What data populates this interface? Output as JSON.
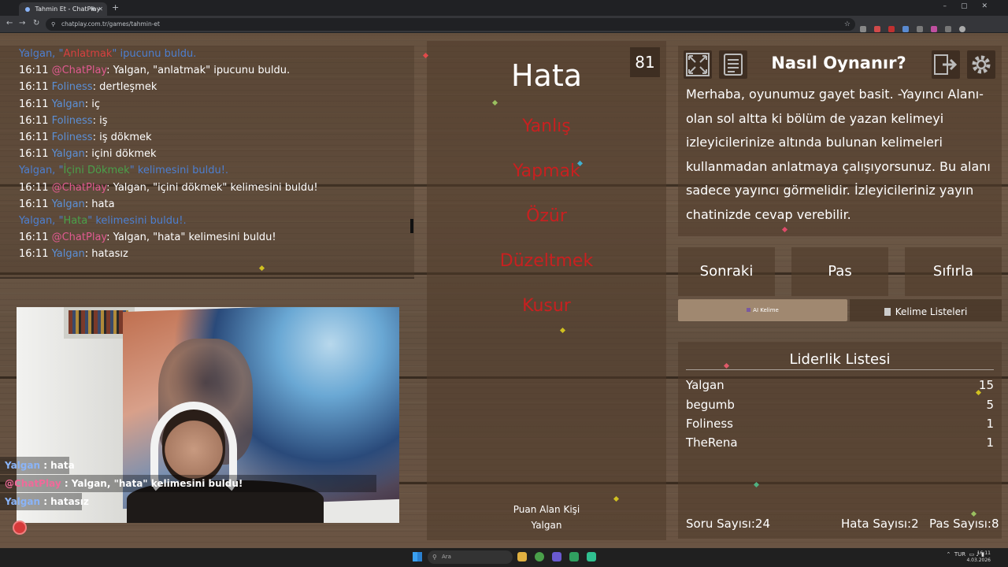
{
  "browser": {
    "tab_title": "Tahmin Et - ChatPlay",
    "url": "chatplay.com.tr/games/tahmin-et"
  },
  "chat": {
    "lines": [
      {
        "kind": "system",
        "parts": [
          {
            "text": "Yalgan, \"",
            "style": "blue"
          },
          {
            "text": "Anlatmak",
            "style": "red"
          },
          {
            "text": "\" ipucunu buldu.",
            "style": "blue"
          }
        ]
      },
      {
        "kind": "msg",
        "time": "16:11",
        "user": "@ChatPlay",
        "user_style": "chatplay",
        "text": ": Yalgan, \"anlatmak\" ipucunu buldu."
      },
      {
        "kind": "msg",
        "time": "16:11",
        "user": "Foliness",
        "user_style": "blue",
        "text": ": dertleşmek"
      },
      {
        "kind": "msg",
        "time": "16:11",
        "user": "Yalgan",
        "user_style": "blue",
        "text": ": iç"
      },
      {
        "kind": "msg",
        "time": "16:11",
        "user": "Foliness",
        "user_style": "blue",
        "text": ": iş"
      },
      {
        "kind": "msg",
        "time": "16:11",
        "user": "Foliness",
        "user_style": "blue",
        "text": ": iş dökmek"
      },
      {
        "kind": "msg",
        "time": "16:11",
        "user": "Yalgan",
        "user_style": "blue",
        "text": ": içini dökmek"
      },
      {
        "kind": "system",
        "parts": [
          {
            "text": "Yalgan, \"",
            "style": "blue"
          },
          {
            "text": "İçini Dökmek",
            "style": "green"
          },
          {
            "text": "\" kelimesini buldu!.",
            "style": "blue"
          }
        ]
      },
      {
        "kind": "msg",
        "time": "16:11",
        "user": "@ChatPlay",
        "user_style": "chatplay",
        "text": ": Yalgan, \"içini dökmek\" kelimesini buldu!"
      },
      {
        "kind": "msg",
        "time": "16:11",
        "user": "Yalgan",
        "user_style": "blue",
        "text": ": hata"
      },
      {
        "kind": "system",
        "parts": [
          {
            "text": "Yalgan, \"",
            "style": "blue"
          },
          {
            "text": "Hata",
            "style": "green"
          },
          {
            "text": "\" kelimesini buldu!.",
            "style": "blue"
          }
        ]
      },
      {
        "kind": "msg",
        "time": "16:11",
        "user": "@ChatPlay",
        "user_style": "chatplay",
        "text": ": Yalgan, \"hata\" kelimesini buldu!"
      },
      {
        "kind": "msg",
        "time": "16:11",
        "user": "Yalgan",
        "user_style": "blue",
        "text": ": hatasız"
      }
    ]
  },
  "webcam_overlay": [
    {
      "user": "Yalgan",
      "user_color": "#8ab4f8",
      "text": " : hata"
    },
    {
      "user": "@ChatPlay",
      "user_color": "#f06a9a",
      "text": " : Yalgan, \"hata\" kelimesini buldu!"
    },
    {
      "user": "Yalgan",
      "user_color": "#8ab4f8",
      "text": " : hatasız"
    }
  ],
  "card": {
    "timer": "81",
    "main_word": "Hata",
    "forbidden_words": [
      "Yanlış",
      "Yapmak",
      "Özür",
      "Düzeltmek",
      "Kusur"
    ],
    "scorer_label": "Puan Alan Kişi",
    "scorer_name": "Yalgan"
  },
  "howto": {
    "title": "Nasıl Oynanır?",
    "text": "Merhaba, oyunumuz gayet basit. -Yayıncı Alanı- olan sol altta ki bölüm de yazan kelimeyi izleyicilerinize altında bulunan kelimeleri kullanmadan anlatmaya çalışıyorsunuz. Bu alanı sadece yayıncı görmelidir. İzleyicileriniz yayın chatinizde cevap verebilir."
  },
  "controls": {
    "next": "Sonraki",
    "pass": "Pas",
    "reset": "Sıfırla",
    "ai_word": "AI Kelime",
    "word_lists": "Kelime Listeleri"
  },
  "leaderboard": {
    "title": "Liderlik Listesi",
    "rows": [
      {
        "name": "Yalgan",
        "score": "15"
      },
      {
        "name": "begumb",
        "score": "5"
      },
      {
        "name": "Foliness",
        "score": "1"
      },
      {
        "name": "TheRena",
        "score": "1"
      }
    ]
  },
  "stats": {
    "questions": "Soru Sayısı:24",
    "errors": "Hata Sayısı:2",
    "passes": "Pas Sayısı:8"
  },
  "taskbar": {
    "search_placeholder": "Ara",
    "lang": "TUR",
    "time": "16:11",
    "date": "4.03.2026"
  },
  "colors": {
    "forbidden": "#c82020",
    "chat_user": "#5b8fd6",
    "chatplay_user": "#e05a90"
  }
}
